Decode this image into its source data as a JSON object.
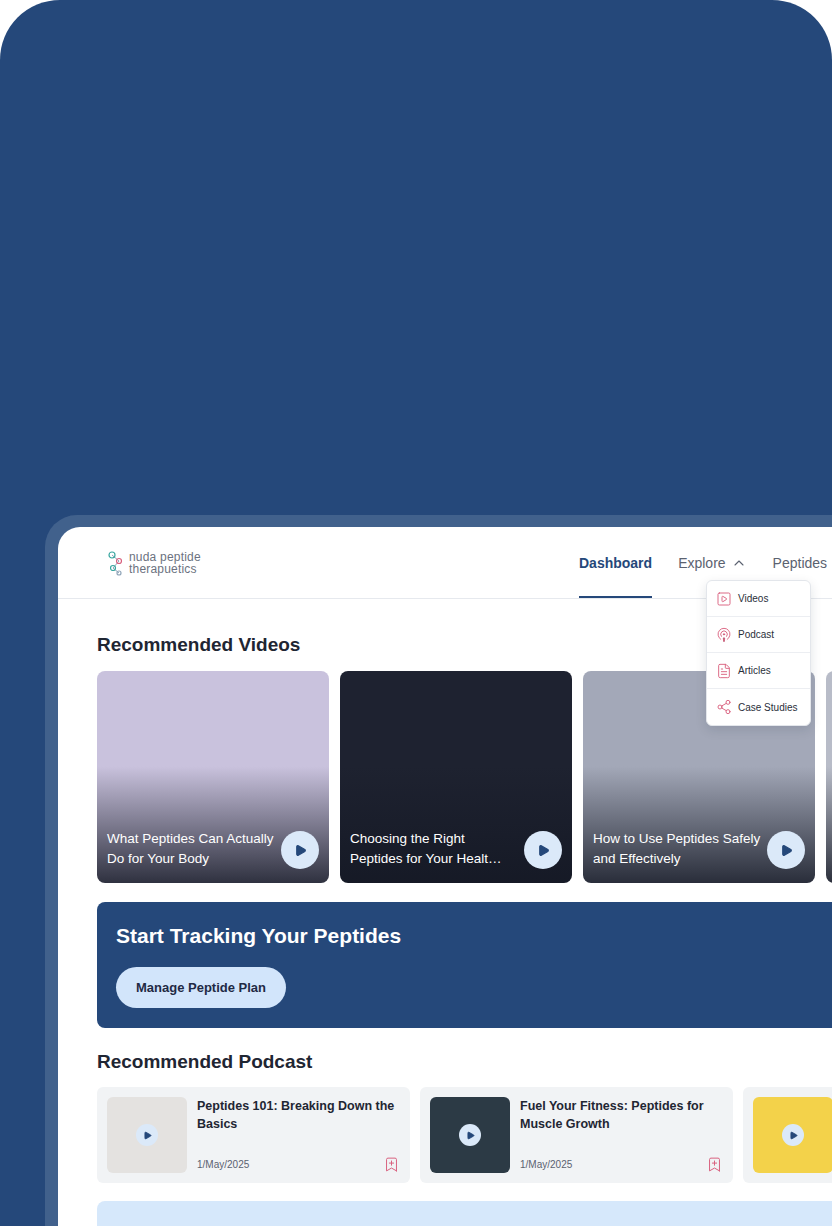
{
  "brand": {
    "name": "nuda peptide",
    "tagline": "therapuetics"
  },
  "nav": [
    {
      "label": "Dashboard",
      "selected": true,
      "kind": "link",
      "expanded": false
    },
    {
      "label": "Explore",
      "selected": false,
      "kind": "menu",
      "expanded": true
    },
    {
      "label": "Peptides",
      "selected": false,
      "kind": "link",
      "expanded": false
    }
  ],
  "explore_menu": [
    {
      "label": "Videos"
    },
    {
      "label": "Podcast"
    },
    {
      "label": "Articles"
    },
    {
      "label": "Case Studies"
    }
  ],
  "videos": {
    "title": "Recommended Videos",
    "items": [
      {
        "title": "What Peptides Can Actually Do for Your Body",
        "color": "#c9c2dd"
      },
      {
        "title": "Choosing the Right Peptides for Your Healt…",
        "color": "#1e2230"
      },
      {
        "title": "How to Use Peptides Safely and Effectively",
        "color": "#a3a8b8"
      }
    ]
  },
  "tracking_banner": {
    "title": "Start Tracking Your Peptides",
    "button": "Manage Peptide Plan"
  },
  "podcasts": {
    "title": "Recommended Podcast",
    "items": [
      {
        "title": "Peptides 101: Breaking Down the Basics",
        "date": "1/May/2025",
        "bookmarked": false,
        "color": "#e4e2e0"
      },
      {
        "title": "Fuel Your Fitness: Peptides for Muscle Growth",
        "date": "1/May/2025",
        "bookmarked": false,
        "color": "#2c3a45"
      }
    ]
  }
}
